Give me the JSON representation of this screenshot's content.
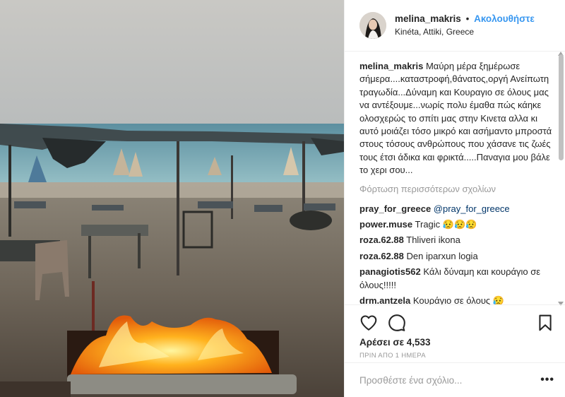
{
  "header": {
    "username": "melina_makris",
    "separator": "•",
    "follow_label": "Ακολουθήστε",
    "location": "Kinéta, Attiki, Greece"
  },
  "caption": {
    "username": "melina_makris",
    "text": "Μαύρη μέρα ξημέρωσε σήμερα....καταστροφή,θάνατος,οργή Ανείπωτη τραγωδία...Δύναμη και Κουραγιο σε όλους μας να αντέξουμε...νωρίς πολυ έμαθα πώς κάηκε ολοσχερώς το σπίτι μας στην Κινετα αλλα κι αυτό μοιάζει τόσο μικρό και ασήμαντο μπροστά στους τόσους ανθρώπους που χάσανε τις ζωές τους έτσι άδικα και φρικτά.....Παναγια μου βάλε το χερι σου..."
  },
  "load_more_label": "Φόρτωση περισσότερων σχολίων",
  "comments": [
    {
      "user": "pray_for_greece",
      "text": "",
      "mention": "@pray_for_greece"
    },
    {
      "user": "power.muse",
      "text": "Tragic 😥😥😥",
      "mention": ""
    },
    {
      "user": "roza.62.88",
      "text": "Thliveri ikona",
      "mention": ""
    },
    {
      "user": "roza.62.88",
      "text": "Den iparxun logia",
      "mention": ""
    },
    {
      "user": "panagiotis562",
      "text": "Κάλι δύναμη και κουράγιο σε όλους!!!!!",
      "mention": ""
    },
    {
      "user": "drm.antzela",
      "text": "Κουράγιο σε όλους 😥",
      "mention": ""
    }
  ],
  "actions": {
    "like_icon": "heart-icon",
    "comment_icon": "comment-bubble-icon",
    "save_icon": "bookmark-icon",
    "likes_text": "Αρέσει σε 4,533",
    "timestamp": "ΠΡΙΝ ΑΠΟ 1 ΗΜΕΡΑ"
  },
  "add_comment": {
    "placeholder": "Προσθέστε ένα σχόλιο...",
    "more_label": "•••"
  },
  "colors": {
    "link_blue": "#3897f0",
    "mention_blue": "#003569",
    "muted_gray": "#999999",
    "border": "#efefef"
  },
  "photo": {
    "description_icon": "post-photo",
    "alt": ""
  }
}
